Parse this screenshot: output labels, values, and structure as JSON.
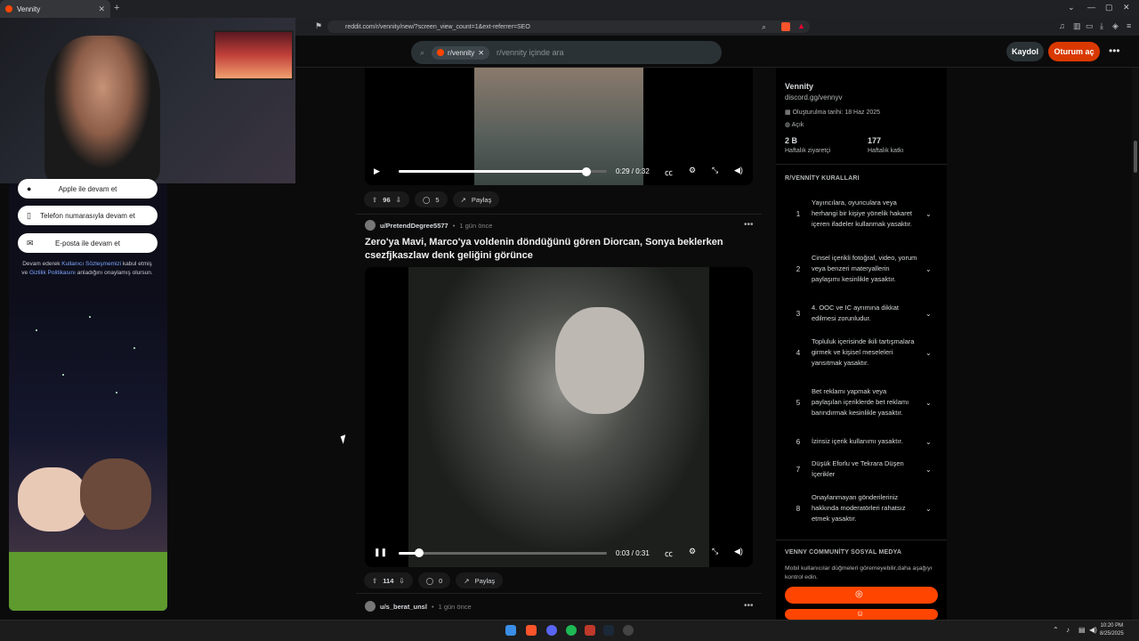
{
  "browser": {
    "tab_title": "Vennity",
    "url": "reddit.com/r/vennity/new/?screen_view_count=1&ext-referrer=SEO"
  },
  "header": {
    "search_chip": "r/vennity",
    "search_placeholder": "r/vennity içinde ara",
    "signup_label": "Kaydol",
    "login_label": "Oturum aç"
  },
  "left_panel": {
    "apple_label": "Apple ile devam et",
    "phone_label": "Telefon numarasıyla devam et",
    "email_label": "E-posta ile devam et",
    "terms_pre": "Devam ederek ",
    "terms_link1": "Kullanıcı Sözleşmemizi",
    "terms_mid": " kabul etmiş ve ",
    "terms_link2": "Gizlilik Politikasını",
    "terms_post": " anladığını onaylamış olursun."
  },
  "post1": {
    "time": "0:29 / 0:32",
    "progress": 0.9,
    "votes": "96",
    "comments": "5",
    "share": "Paylaş"
  },
  "post2": {
    "user": "u/PretendDegree5577",
    "ago": "1 gün önce",
    "title": "Zero'ya Mavi, Marco'ya voldenin döndüğünü gören Diorcan, Sonya beklerken csezfjkaszlaw denk geliğini görünce",
    "time": "0:03 / 0:31",
    "progress": 0.1,
    "votes": "114",
    "comments": "0",
    "share": "Paylaş"
  },
  "post3": {
    "user": "u/s_berat_unsl",
    "ago": "1 gün önce"
  },
  "sidebar": {
    "community_name": "Vennity",
    "community_link": "discord.gg/vennyv",
    "created": "Oluşturulma tarihi: 18 Haz 2025",
    "visibility": "Açık",
    "stat1_value": "2 B",
    "stat1_label": "Haftalık ziyaretçi",
    "stat2_value": "177",
    "stat2_label": "Haftalık katkı",
    "rules_title": "R/VENNİTY KURALLARI",
    "rules": [
      {
        "num": "1",
        "text": "Yayıncılara, oyunculara veya herhangi bir kişiye yönelik hakaret içeren ifadeler kullanmak yasaktır."
      },
      {
        "num": "2",
        "text": "Cinsel içerikli fotoğraf, video, yorum veya benzeri materyallerin paylaşımı kesinlikle yasaktır."
      },
      {
        "num": "3",
        "text": "4. OOC ve IC ayrımına dikkat edilmesi zorunludur."
      },
      {
        "num": "4",
        "text": "Topluluk içerisinde ikili tartışmalara girmek ve kişisel meseleleri yansıtmak yasaktır."
      },
      {
        "num": "5",
        "text": "Bet reklamı yapmak veya paylaşılan içeriklerde bet reklamı barındırmak kesinlikle yasaktır."
      },
      {
        "num": "6",
        "text": "İzinsiz içerik kullanımı yasaktır."
      },
      {
        "num": "7",
        "text": "Düşük Eforlu ve Tekrara Düşen İçerikler"
      },
      {
        "num": "8",
        "text": "Onaylanmayan gönderileriniz hakkında moderatörleri rahatsız etmek yasaktır."
      }
    ],
    "social_title": "VENNY COMMUNİTY SOSYAL MEDYA",
    "social_desc": "Mobil kullanıcılar düğmeleri göremeyebilir,daha aşağıyı kontrol edin."
  },
  "taskbar": {
    "time": "10:20 PM",
    "date": "8/25/2025"
  },
  "colors": {
    "accent": "#ff4500",
    "login_button": "#d93900",
    "background": "#0b0b0c"
  }
}
